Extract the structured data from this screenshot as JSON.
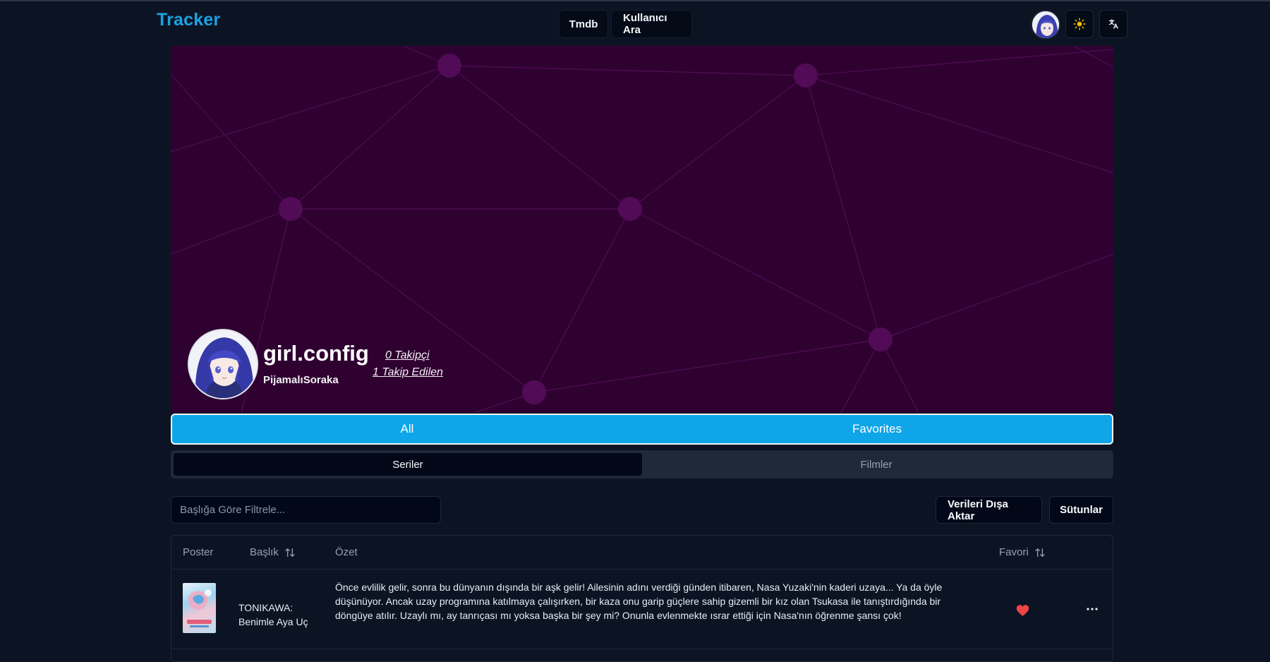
{
  "header": {
    "brand": "Tracker",
    "nav": [
      {
        "label": "Tmdb"
      },
      {
        "label": "Kullanıcı Ara"
      }
    ],
    "icons": [
      "user-avatar",
      "sun-icon",
      "translate-icon"
    ]
  },
  "profile": {
    "display_name": "girl.config",
    "username": "PijamalıSoraka",
    "followers": "0 Takipçi",
    "following": "1 Takip Edilen"
  },
  "segment": {
    "all": "All",
    "favorites": "Favorites",
    "active": "All"
  },
  "tabs": {
    "series": "Seriler",
    "movies": "Filmler",
    "active": "Seriler"
  },
  "toolbar": {
    "filter_placeholder": "Başlığa Göre Filtrele...",
    "filter_value": "",
    "export_label": "Verileri Dışa Aktar",
    "columns_label": "Sütunlar"
  },
  "table": {
    "columns": {
      "poster": "Poster",
      "title": "Başlık",
      "summary": "Özet",
      "favorite": "Favori"
    },
    "rows": [
      {
        "title": "TONIKAWA: Benimle Aya Uç",
        "summary": "Önce evlilik gelir, sonra bu dünyanın dışında bir aşk gelir! Ailesinin adını verdiği günden itibaren, Nasa Yuzaki'nin kaderi uzaya... Ya da öyle düşünüyor. Ancak uzay programına katılmaya çalışırken, bir kaza onu garip güçlere sahip gizemli bir kız olan Tsukasa ile tanıştırdığında bir döngüye atılır. Uzaylı mı, ay tanrıçası mı yoksa başka bir şey mi? Onunla evlenmekte ısrar ettiği için Nasa'nın öğrenme şansı çok!",
        "favorite": true
      }
    ]
  },
  "colors": {
    "background": "#0c1424",
    "brand": "#1ba1e3",
    "banner": "#2f0131",
    "segment_active": "#0ea5e9",
    "favorite": "#ef4444"
  }
}
